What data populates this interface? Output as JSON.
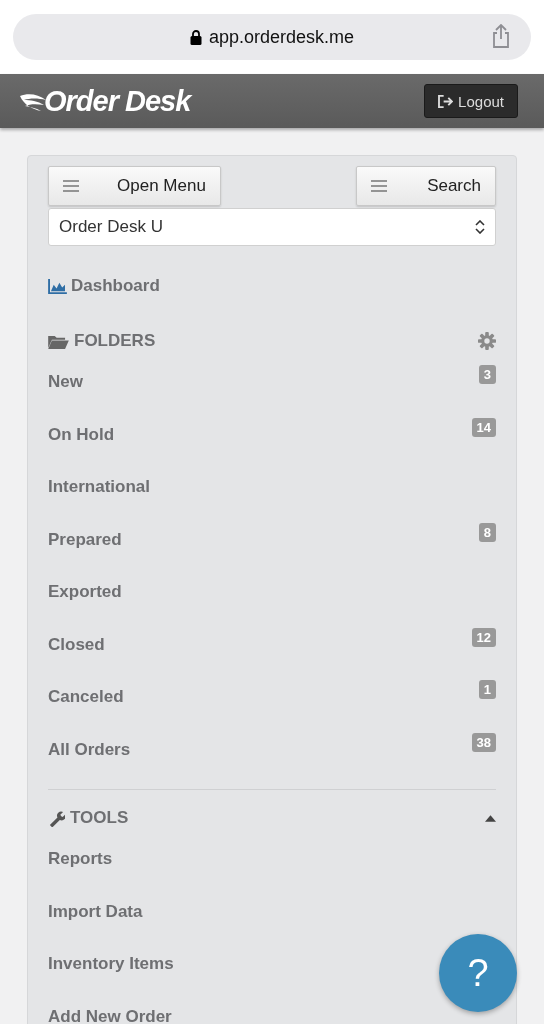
{
  "browser": {
    "url": "app.orderdesk.me"
  },
  "header": {
    "logo": "Order Desk",
    "logout_button": "Logout"
  },
  "menu_button": "Open Menu",
  "search_button": "Search",
  "store_select": {
    "value": "Order Desk U"
  },
  "dashboard_link": "Dashboard",
  "folders": {
    "title": "FOLDERS",
    "items": [
      {
        "label": "New",
        "badge": "3"
      },
      {
        "label": "On Hold",
        "badge": "14"
      },
      {
        "label": "International"
      },
      {
        "label": "Prepared",
        "badge": "8"
      },
      {
        "label": "Exported"
      },
      {
        "label": "Closed",
        "badge": "12"
      },
      {
        "label": "Canceled",
        "badge": "1"
      },
      {
        "label": "All Orders",
        "badge": "38"
      }
    ]
  },
  "tools": {
    "title": "TOOLS",
    "expanded": true,
    "items": [
      {
        "label": "Reports"
      },
      {
        "label": "Import Data"
      },
      {
        "label": "Inventory Items"
      },
      {
        "label": "Add New Order"
      }
    ]
  },
  "help_button": "?"
}
